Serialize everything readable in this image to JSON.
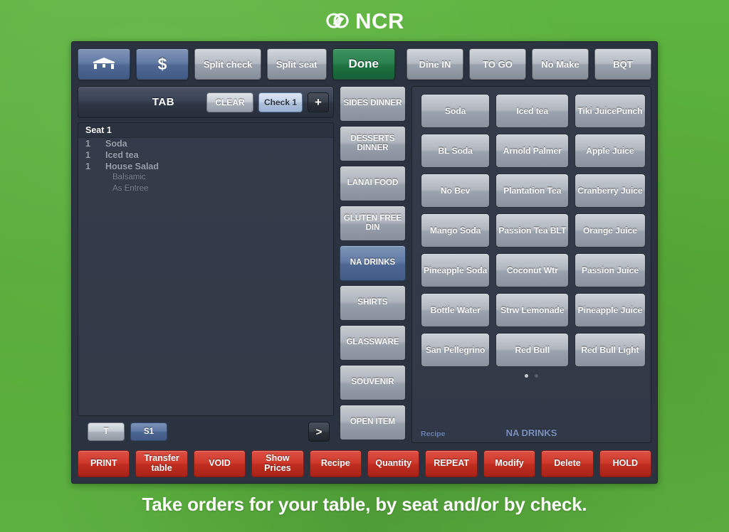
{
  "brand": {
    "logo_icon": "ncr-logo-icon",
    "name": "NCR"
  },
  "caption": "Take orders for your table, by seat and/or by check.",
  "toolbar": {
    "table_icon": "table-icon",
    "dollar_icon": "dollar-sign-icon",
    "split_check": "Split check",
    "split_seat": "Split seat",
    "done": "Done",
    "dine_in": "Dine IN",
    "to_go": "TO GO",
    "no_make": "No Make",
    "bqt": "BQT"
  },
  "order_panel": {
    "title": "TAB",
    "clear_label": "CLEAR",
    "check_label": "Check 1",
    "add_label": "+",
    "seat_header": "Seat 1",
    "items": [
      {
        "qty": "1",
        "name": "Soda",
        "modifiers": []
      },
      {
        "qty": "1",
        "name": "Iced tea",
        "modifiers": []
      },
      {
        "qty": "1",
        "name": "House Salad",
        "modifiers": [
          "Balsamic",
          "As Entree"
        ]
      }
    ],
    "seat_buttons": [
      {
        "label": "T",
        "active": false
      },
      {
        "label": "S1",
        "active": true
      }
    ],
    "next_label": ">"
  },
  "categories": [
    {
      "label": "SIDES\nDINNER",
      "active": false
    },
    {
      "label": "DESSERTS\nDINNER",
      "active": false
    },
    {
      "label": "LANAI FOOD",
      "active": false
    },
    {
      "label": "GLUTEN\nFREE DIN",
      "active": false
    },
    {
      "label": "NA DRINKS",
      "active": true
    },
    {
      "label": "SHIRTS",
      "active": false
    },
    {
      "label": "GLASSWARE",
      "active": false
    },
    {
      "label": "SOUVENIR",
      "active": false
    },
    {
      "label": "OPEN ITEM",
      "active": false
    }
  ],
  "products": [
    "Soda",
    "Iced tea",
    "Tiki JuicePunch",
    "BL Soda",
    "Arnold Palmer",
    "Apple Juice",
    "No Bev",
    "Plantation Tea",
    "Cranberry Juice",
    "Mango Soda",
    "Passion Tea BLT",
    "Orange Juice",
    "Pineapple Soda",
    "Coconut Wtr",
    "Passion Juice",
    "Bottle Water",
    "Strw Lemonade",
    "Pineapple Juice",
    "San Pellegrino",
    "Red Bull",
    "Red Bull Light"
  ],
  "pagination": {
    "pages": 2,
    "current": 1
  },
  "grid_footer": {
    "recipe_label": "Recipe",
    "category_label": "NA DRINKS"
  },
  "actions": [
    "PRINT",
    "Transfer\ntable",
    "VOID",
    "Show\nPrices",
    "Recipe",
    "Quantity",
    "REPEAT",
    "Modify",
    "Delete",
    "HOLD"
  ],
  "colors": {
    "background_green": "#5cb13d",
    "panel_dark": "#2b3341",
    "accent_blue": "#4f6894",
    "done_green": "#1f7342",
    "action_red": "#bf2d20"
  }
}
